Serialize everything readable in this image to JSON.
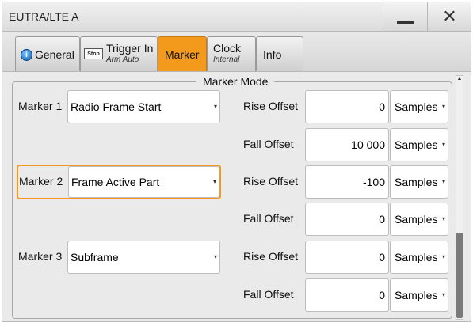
{
  "window": {
    "title": "EUTRA/LTE A",
    "minimize_glyph": "—",
    "close_glyph": "✕"
  },
  "tabs": [
    {
      "label": "General",
      "icon": "info-icon",
      "icon_glyph": "i",
      "active": false
    },
    {
      "label": "Trigger In",
      "sub": "Arm Auto",
      "icon": "stop-icon",
      "icon_glyph": "Stop",
      "active": false
    },
    {
      "label": "Marker",
      "active": true
    },
    {
      "label": "Clock",
      "sub": "Internal",
      "active": false
    },
    {
      "label": "Info",
      "active": false
    }
  ],
  "group": {
    "title": "Marker Mode"
  },
  "markers": [
    {
      "label": "Marker 1",
      "mode": "Radio Frame Start"
    },
    {
      "label": "Marker 2",
      "mode": "Frame Active Part"
    },
    {
      "label": "Marker 3",
      "mode": "Subframe"
    }
  ],
  "offsets": [
    {
      "label": "Rise Offset",
      "value": "0",
      "unit": "Samples"
    },
    {
      "label": "Fall Offset",
      "value": "10 000",
      "unit": "Samples"
    },
    {
      "label": "Rise Offset",
      "value": "-100",
      "unit": "Samples"
    },
    {
      "label": "Fall Offset",
      "value": "0",
      "unit": "Samples"
    },
    {
      "label": "Rise Offset",
      "value": "0",
      "unit": "Samples"
    },
    {
      "label": "Fall Offset",
      "value": "0",
      "unit": "Samples"
    }
  ],
  "colors": {
    "accent": "#f39a1d",
    "panel": "#eaeaea",
    "field": "#ffffff"
  }
}
